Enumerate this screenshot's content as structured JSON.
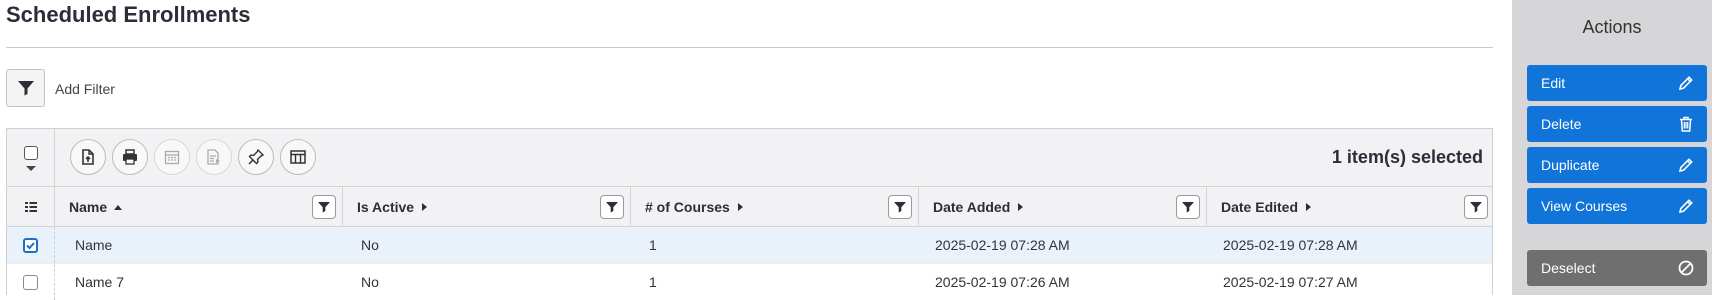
{
  "page": {
    "title": "Scheduled Enrollments"
  },
  "filter": {
    "add_filter_label": "Add Filter"
  },
  "toolbar": {
    "selected_count": "1 item(s) selected",
    "tools": [
      "export-icon",
      "print-icon",
      "calendar-icon",
      "report-icon",
      "pin-icon",
      "columns-icon"
    ]
  },
  "columns": [
    {
      "label": "Name",
      "sort": "ascending"
    },
    {
      "label": "Is Active",
      "sort": "none"
    },
    {
      "label": "# of Courses",
      "sort": "none"
    },
    {
      "label": "Date Added",
      "sort": "none"
    },
    {
      "label": "Date Edited",
      "sort": "none"
    }
  ],
  "rows": [
    {
      "selected": true,
      "name": "Name",
      "is_active": "No",
      "courses": "1",
      "date_added": "2025-02-19 07:28 AM",
      "date_edited": "2025-02-19 07:28 AM"
    },
    {
      "selected": false,
      "name": "Name 7",
      "is_active": "No",
      "courses": "1",
      "date_added": "2025-02-19 07:26 AM",
      "date_edited": "2025-02-19 07:27 AM"
    }
  ],
  "sidebar": {
    "title": "Actions",
    "actions": [
      {
        "label": "Edit",
        "icon": "pencil-icon"
      },
      {
        "label": "Delete",
        "icon": "trash-icon"
      },
      {
        "label": "Duplicate",
        "icon": "pencil-icon"
      },
      {
        "label": "View Courses",
        "icon": "pencil-icon"
      }
    ],
    "deselect": {
      "label": "Deselect",
      "icon": "cancel-icon"
    }
  },
  "colors": {
    "accent": "#1174d9",
    "sidebar_bg": "#d6d6d9",
    "selected_row": "#e9f2fb",
    "deselect": "#6f6f6f"
  }
}
